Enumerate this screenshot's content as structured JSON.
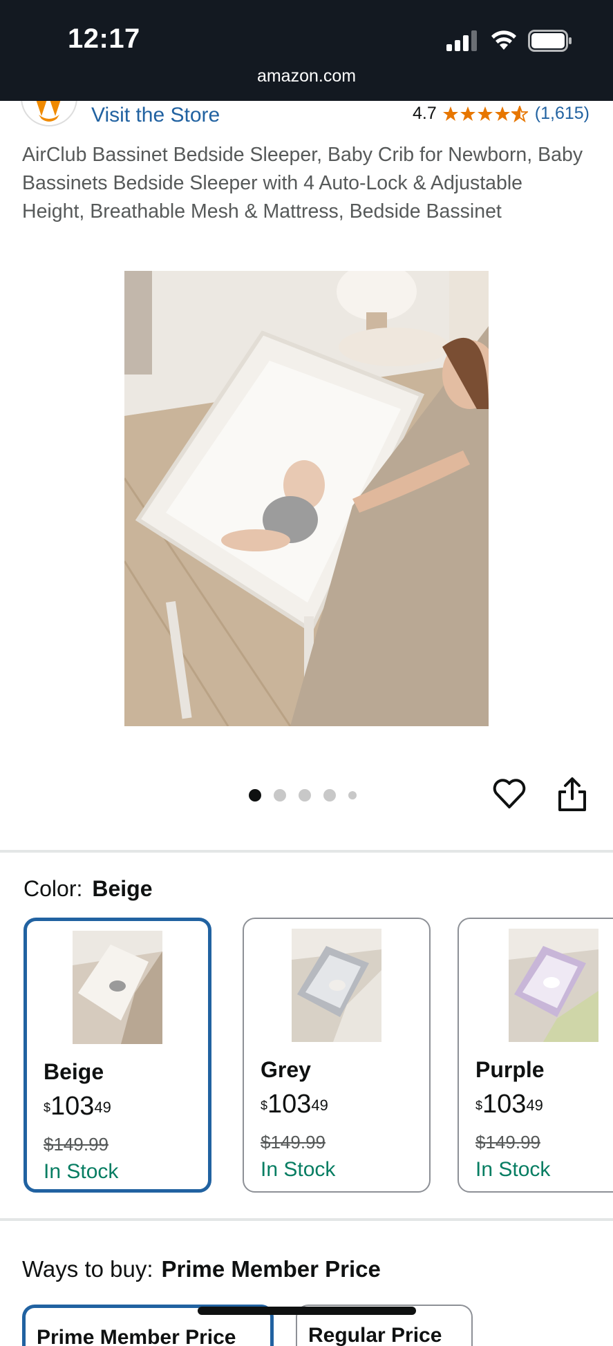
{
  "status_bar": {
    "time": "12:17",
    "url": "amazon.com"
  },
  "brand": {
    "visit_store": "Visit the Store",
    "rating": "4.7",
    "rating_count": "(1,615)",
    "star_color": "#e77600"
  },
  "product": {
    "title": "AirClub Bassinet Bedside Sleeper, Baby Crib for Newborn, Baby Bassinets Bedside Sleeper with 4 Auto-Lock & Adjustable Height, Breathable Mesh & Mattress, Bedside Bassinet"
  },
  "carousel": {
    "count": 5,
    "active": 0
  },
  "color": {
    "label": "Color:",
    "selected": "Beige",
    "options": [
      {
        "name": "Beige",
        "dollars": "103",
        "cents": "49",
        "was": "$149.99",
        "stock": "In Stock"
      },
      {
        "name": "Grey",
        "dollars": "103",
        "cents": "49",
        "was": "$149.99",
        "stock": "In Stock"
      },
      {
        "name": "Purple",
        "dollars": "103",
        "cents": "49",
        "was": "$149.99",
        "stock": "In Stock"
      }
    ]
  },
  "ways_to_buy": {
    "label": "Ways to buy:",
    "selected": "Prime Member Price",
    "options": [
      "Prime Member Price",
      "Regular Price"
    ]
  },
  "colors": {
    "link": "#2162a1",
    "stock": "#067d62",
    "header_bg": "#131921"
  }
}
